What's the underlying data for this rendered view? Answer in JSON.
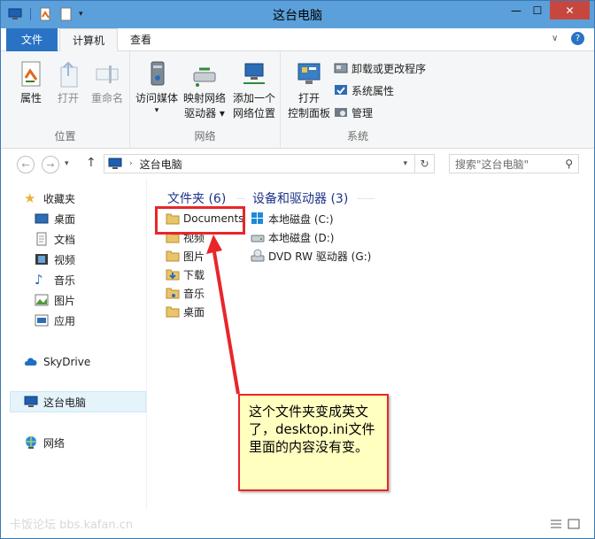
{
  "window": {
    "title": "这台电脑"
  },
  "titlebar": {
    "close_label": "✕",
    "minimize_label": "—",
    "maximize_label": "☐"
  },
  "tabs": {
    "file": "文件",
    "computer": "计算机",
    "view": "查看"
  },
  "ribbon": {
    "location": {
      "label": "位置",
      "items": [
        {
          "label": "属性",
          "enabled": true
        },
        {
          "label": "打开",
          "enabled": false
        },
        {
          "label": "重命名",
          "enabled": false
        }
      ]
    },
    "network": {
      "label": "网络",
      "items": [
        {
          "label": "访问媒体"
        },
        {
          "label": "映射网络",
          "label2": "驱动器 ▾"
        },
        {
          "label": "添加一个",
          "label2": "网络位置"
        }
      ]
    },
    "system": {
      "label": "系统",
      "open_cp": {
        "label": "打开",
        "label2": "控制面板"
      },
      "uninstall": "卸载或更改程序",
      "sys_props": "系统属性",
      "manage": "管理"
    }
  },
  "address": {
    "path": "这台电脑",
    "search_placeholder": "搜索\"这台电脑\""
  },
  "nav": {
    "favorites": "收藏夹",
    "desktop": "桌面",
    "documents": "文档",
    "videos": "视频",
    "music": "音乐",
    "pictures": "图片",
    "apps": "应用",
    "skydrive": "SkyDrive",
    "this_pc": "这台电脑",
    "network": "网络"
  },
  "folders": {
    "header": "文件夹 (6)",
    "items": [
      "Documents",
      "视频",
      "图片",
      "下载",
      "音乐",
      "桌面"
    ]
  },
  "devices": {
    "header": "设备和驱动器 (3)",
    "items": [
      "本地磁盘 (C:)",
      "本地磁盘 (D:)",
      "DVD RW 驱动器 (G:)"
    ]
  },
  "annotation": {
    "text": "这个文件夹变成英文了，desktop.ini文件里面的内容没有变。"
  },
  "watermark": "卡饭论坛 bbs.kafan.cn",
  "colors": {
    "accent": "#2a73c4",
    "annotation_border": "#e8262a",
    "annotation_bg": "#ffffc0",
    "header_text": "#1e3287"
  }
}
